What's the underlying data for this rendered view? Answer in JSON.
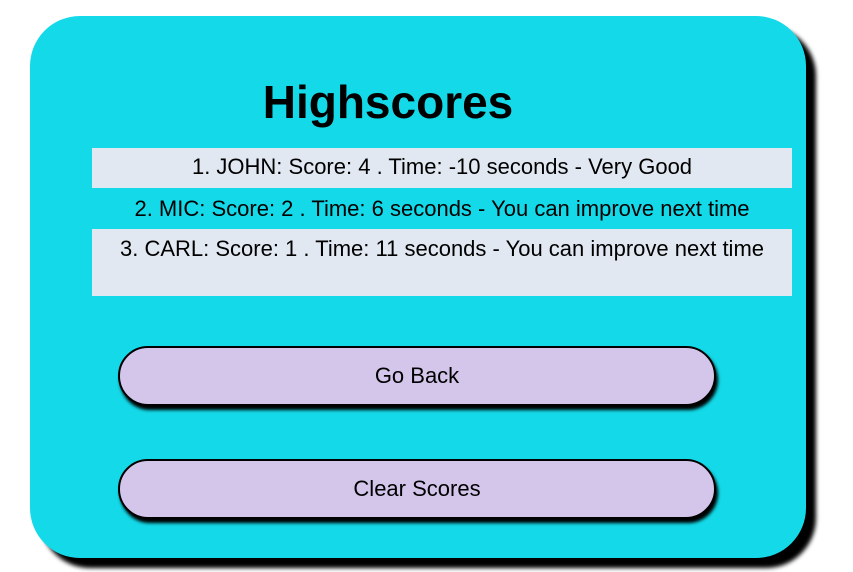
{
  "page": {
    "title": "Highscores"
  },
  "scores": [
    "1. JOHN: Score: 4 . Time: -10 seconds - Very Good",
    "2. MIC: Score: 2 . Time: 6 seconds - You can improve next time",
    "3. CARL: Score: 1 . Time: 11 seconds - You can improve next time"
  ],
  "buttons": {
    "go_back_label": "Go Back",
    "clear_scores_label": "Clear Scores"
  },
  "colors": {
    "card_background": "#14d9e8",
    "row_highlight": "#e1e8f2",
    "button_background": "#d4c5eb"
  }
}
